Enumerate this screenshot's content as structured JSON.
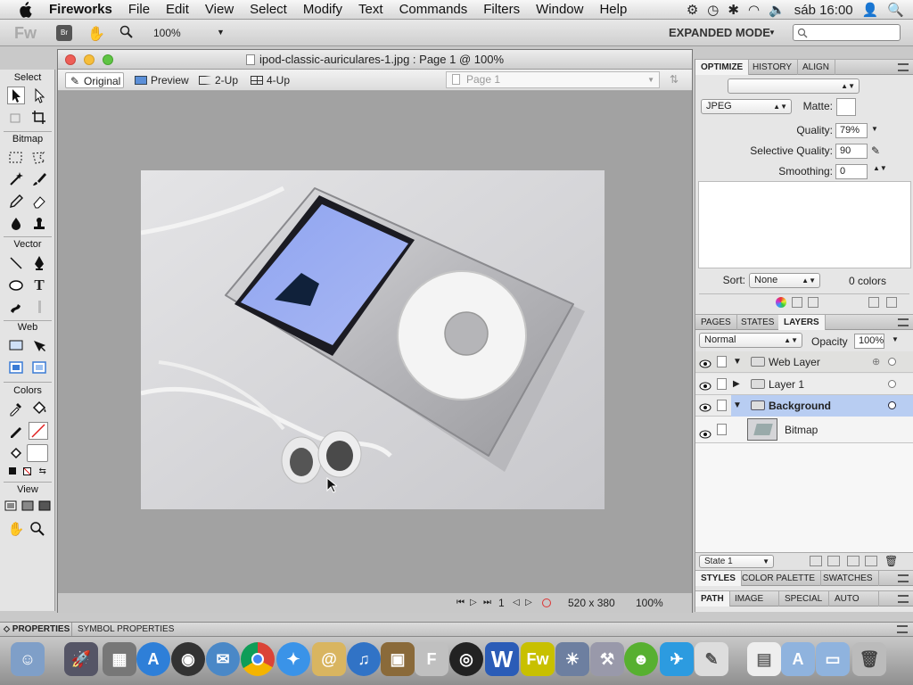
{
  "menubar": {
    "app": "Fireworks",
    "items": [
      "File",
      "Edit",
      "View",
      "Select",
      "Modify",
      "Text",
      "Commands",
      "Filters",
      "Window",
      "Help"
    ],
    "clock": "sáb 16:00"
  },
  "toolbar": {
    "logo": "Fw",
    "zoom": "100%",
    "mode": "EXPANDED MODE"
  },
  "tools": {
    "sections": [
      "Select",
      "Bitmap",
      "Vector",
      "Web",
      "Colors",
      "View"
    ]
  },
  "document": {
    "title": "ipod-classic-auriculares-1.jpg : Page 1 @ 100%",
    "tabs": [
      "Original",
      "Preview",
      "2-Up",
      "4-Up"
    ],
    "page_select": "Page 1",
    "frame": "1",
    "dimensions": "520 x 380",
    "zoom": "100%"
  },
  "optimize": {
    "tabs": [
      "OPTIMIZE",
      "HISTORY",
      "ALIGN"
    ],
    "format": "JPEG",
    "matte_label": "Matte:",
    "quality_label": "Quality:",
    "quality": "79%",
    "selective_label": "Selective Quality:",
    "selective": "90",
    "smoothing_label": "Smoothing:",
    "smoothing": "0",
    "sort_label": "Sort:",
    "sort": "None",
    "colors": "0 colors"
  },
  "layers": {
    "tabs": [
      "PAGES",
      "STATES",
      "LAYERS"
    ],
    "blend": "Normal",
    "opacity_label": "Opacity",
    "opacity": "100%",
    "rows": [
      {
        "name": "Web Layer"
      },
      {
        "name": "Layer 1"
      },
      {
        "name": "Background"
      },
      {
        "name": "Bitmap"
      }
    ],
    "state": "State 1"
  },
  "styles_tabs": [
    "STYLES",
    "COLOR PALETTE",
    "SWATCHES"
  ],
  "path_tabs": [
    "PATH",
    "IMAGE EDI",
    "SPECIAL C",
    "AUTO SHA"
  ],
  "properties_tabs": [
    "PROPERTIES",
    "SYMBOL PROPERTIES"
  ],
  "colors": {
    "selected_layer": "#b8cdf2",
    "accent_blue": "#3a7bd5"
  }
}
